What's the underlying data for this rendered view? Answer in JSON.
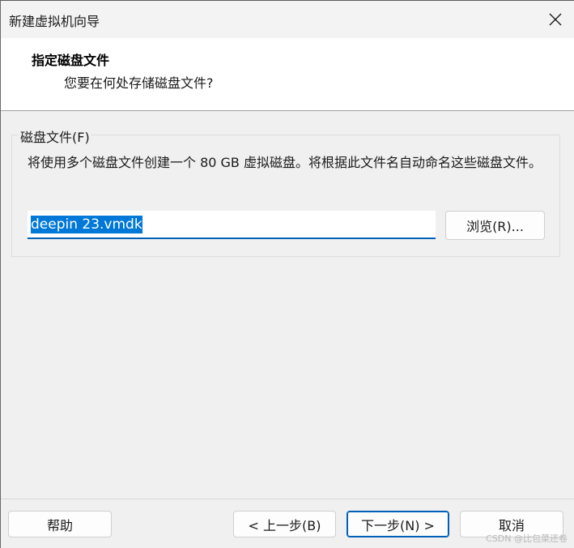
{
  "window": {
    "title": "新建虚拟机向导",
    "close_icon": "close-icon"
  },
  "header": {
    "title": "指定磁盘文件",
    "subtitle": "您要在何处存储磁盘文件?"
  },
  "disk_file_group": {
    "legend": "磁盘文件(F)",
    "description": "将使用多个磁盘文件创建一个 80 GB 虚拟磁盘。将根据此文件名自动命名这些磁盘文件。",
    "file_name_value": "deepin 23.vmdk",
    "browse_label": "浏览(R)..."
  },
  "footer": {
    "help_label": "帮助",
    "back_label": "< 上一步(B)",
    "next_label": "下一步(N) >",
    "cancel_label": "取消"
  },
  "watermark": "CSDN @比包菜还卷",
  "colors": {
    "accent": "#005fb8",
    "selection": "#0078d7",
    "window_bg": "#f0f0f0",
    "header_bg": "#ffffff"
  }
}
